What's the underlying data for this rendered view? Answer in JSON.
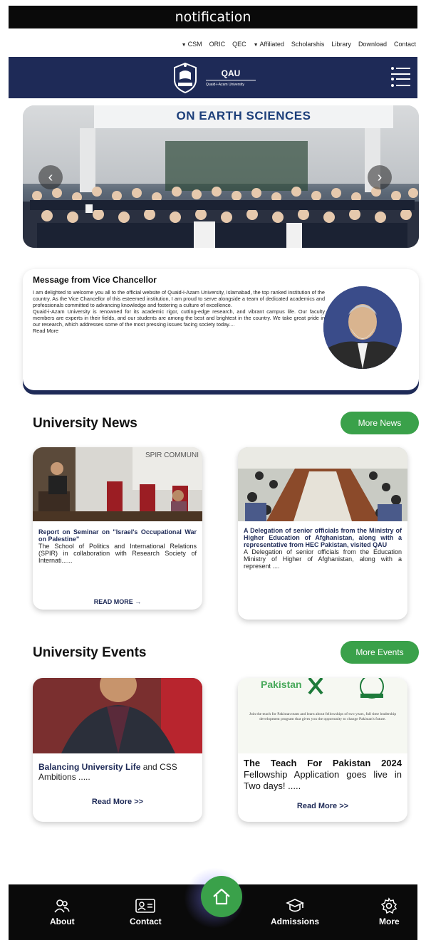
{
  "notification": {
    "text": "notification"
  },
  "top_nav": {
    "items": [
      {
        "label": "CSM",
        "dropdown": true
      },
      {
        "label": "ORIC",
        "dropdown": false
      },
      {
        "label": "QEC",
        "dropdown": false
      },
      {
        "label": "Affiliated",
        "dropdown": true
      },
      {
        "label": "Scholarshis",
        "dropdown": false
      },
      {
        "label": "Library",
        "dropdown": false
      },
      {
        "label": "Download",
        "dropdown": false
      },
      {
        "label": "Contact",
        "dropdown": false
      }
    ]
  },
  "header": {
    "logo_name": "QAU",
    "logo_subtitle": "Quaid-i-Azam University",
    "bg_color": "#1e2a57"
  },
  "hero": {
    "banner_text": "ON EARTH SCIENCES"
  },
  "vc_message": {
    "title": "Message from Vice Chancellor",
    "body_1": "I am delighted to welcome you all to the official website of Quaid-i-Azam University, Islamabad, the top ranked institution of the country. As the Vice Chancellor of this esteemed institution, I am proud to serve alongside a team of dedicated academics and professionals committed to advancing knowledge and fostering a culture of excellence.",
    "body_2": "Quaid-i-Azam University is renowned for its academic rigor, cutting-edge research, and vibrant campus life. Our faculty members are experts in their fields, and our students are among the best and brightest in the country. We take great pride in our research, which addresses some of the most pressing issues facing society today....",
    "read_more": "Read More"
  },
  "news": {
    "title": "University News",
    "more_label": "More News",
    "items": [
      {
        "title": "Report on Seminar on \"Israel's Occupational War on Palestine\"",
        "description": "The School of Politics and International Relations (SPIR) in collaboration with Research Society of Internati......",
        "link": "READ MORE →",
        "image_text": "SPIR COMMUNI"
      },
      {
        "title": "A Delegation of senior officials from the Ministry of Higher Education of Afghanistan, along with a representative from HEC Pakistan, visited QAU",
        "description": "A Delegation of senior officials from the Education Ministry of Higher of Afghanistan, along with a represent ....",
        "link": ""
      }
    ]
  },
  "events": {
    "title": "University Events",
    "more_label": "More Events",
    "items": [
      {
        "title_bold": "Balancing University Life",
        "title_rest": " and CSS Ambitions .....",
        "link": "Read More >>"
      },
      {
        "title_bold": "The Teach For Pakistan 2024",
        "title_rest": " Fellowship Application goes live in Two days! .....",
        "link": "Read More >>",
        "image_brand": "Pakistan",
        "image_caption": "Join the teach for Pakistan team and learn about fellowships of two years, full time leadership development program that gives you the opportunity to change Pakistan's future."
      }
    ]
  },
  "bottom_nav": {
    "about": "About",
    "contact": "Contact",
    "admissions": "Admissions",
    "more": "More"
  },
  "colors": {
    "navy": "#1e2a57",
    "green": "#3aa14a",
    "black": "#0a0a0a"
  }
}
